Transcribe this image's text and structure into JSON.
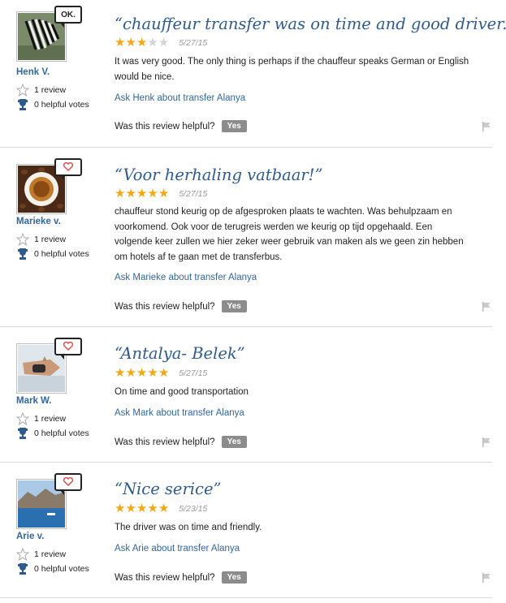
{
  "reviews": [
    {
      "username": "Henk V.",
      "badge": "OK.",
      "review_count": "1 review",
      "helpful_votes": "0 helpful votes",
      "title": "“chauffeur transfer was on time and good driver.”",
      "rating": 3,
      "date": "5/27/15",
      "text": "It was very good. The only thing is perhaps if the chauffeur speaks German or English would be nice.",
      "ask": "Ask Henk about transfer Alanya",
      "helpful_q": "Was this review helpful?",
      "yes": "Yes"
    },
    {
      "username": "Marieke v.",
      "badge": "",
      "review_count": "1 review",
      "helpful_votes": "0 helpful votes",
      "title": "“Voor herhaling vatbaar!”",
      "rating": 5,
      "date": "5/27/15",
      "text": "chauffeur stond keurig op de afgesproken plaats te wachten. Was behulpzaam en voorkomend. Ook voor de terugreis werden we keurig op tijd opgehaald. Een volgende keer zullen we hier zeker weer gebruik van maken als we geen zin hebben om hotels af te gaan met de transferbus.",
      "ask": "Ask Marieke about transfer Alanya",
      "helpful_q": "Was this review helpful?",
      "yes": "Yes"
    },
    {
      "username": "Mark W.",
      "badge": "",
      "review_count": "1 review",
      "helpful_votes": "0 helpful votes",
      "title": "“Antalya- Belek”",
      "rating": 5,
      "date": "5/27/15",
      "text": "On time and good transportation",
      "ask": "Ask Mark about transfer Alanya",
      "helpful_q": "Was this review helpful?",
      "yes": "Yes"
    },
    {
      "username": "Arie v.",
      "badge": "",
      "review_count": "1 review",
      "helpful_votes": "0 helpful votes",
      "title": "“Nice serice”",
      "rating": 5,
      "date": "5/23/15",
      "text": "The driver was on time and friendly.",
      "ask": "Ask Arie about transfer Alanya",
      "helpful_q": "Was this review helpful?",
      "yes": "Yes"
    }
  ],
  "colors": {
    "link": "#336699",
    "title": "#2f5b8c",
    "star": "#f3a812"
  },
  "icons": [
    "zebra-avatar",
    "coffee-avatar",
    "hands-avatar",
    "sea-avatar",
    "heart-icon",
    "star-outline-icon",
    "trophy-icon",
    "flag-icon"
  ]
}
